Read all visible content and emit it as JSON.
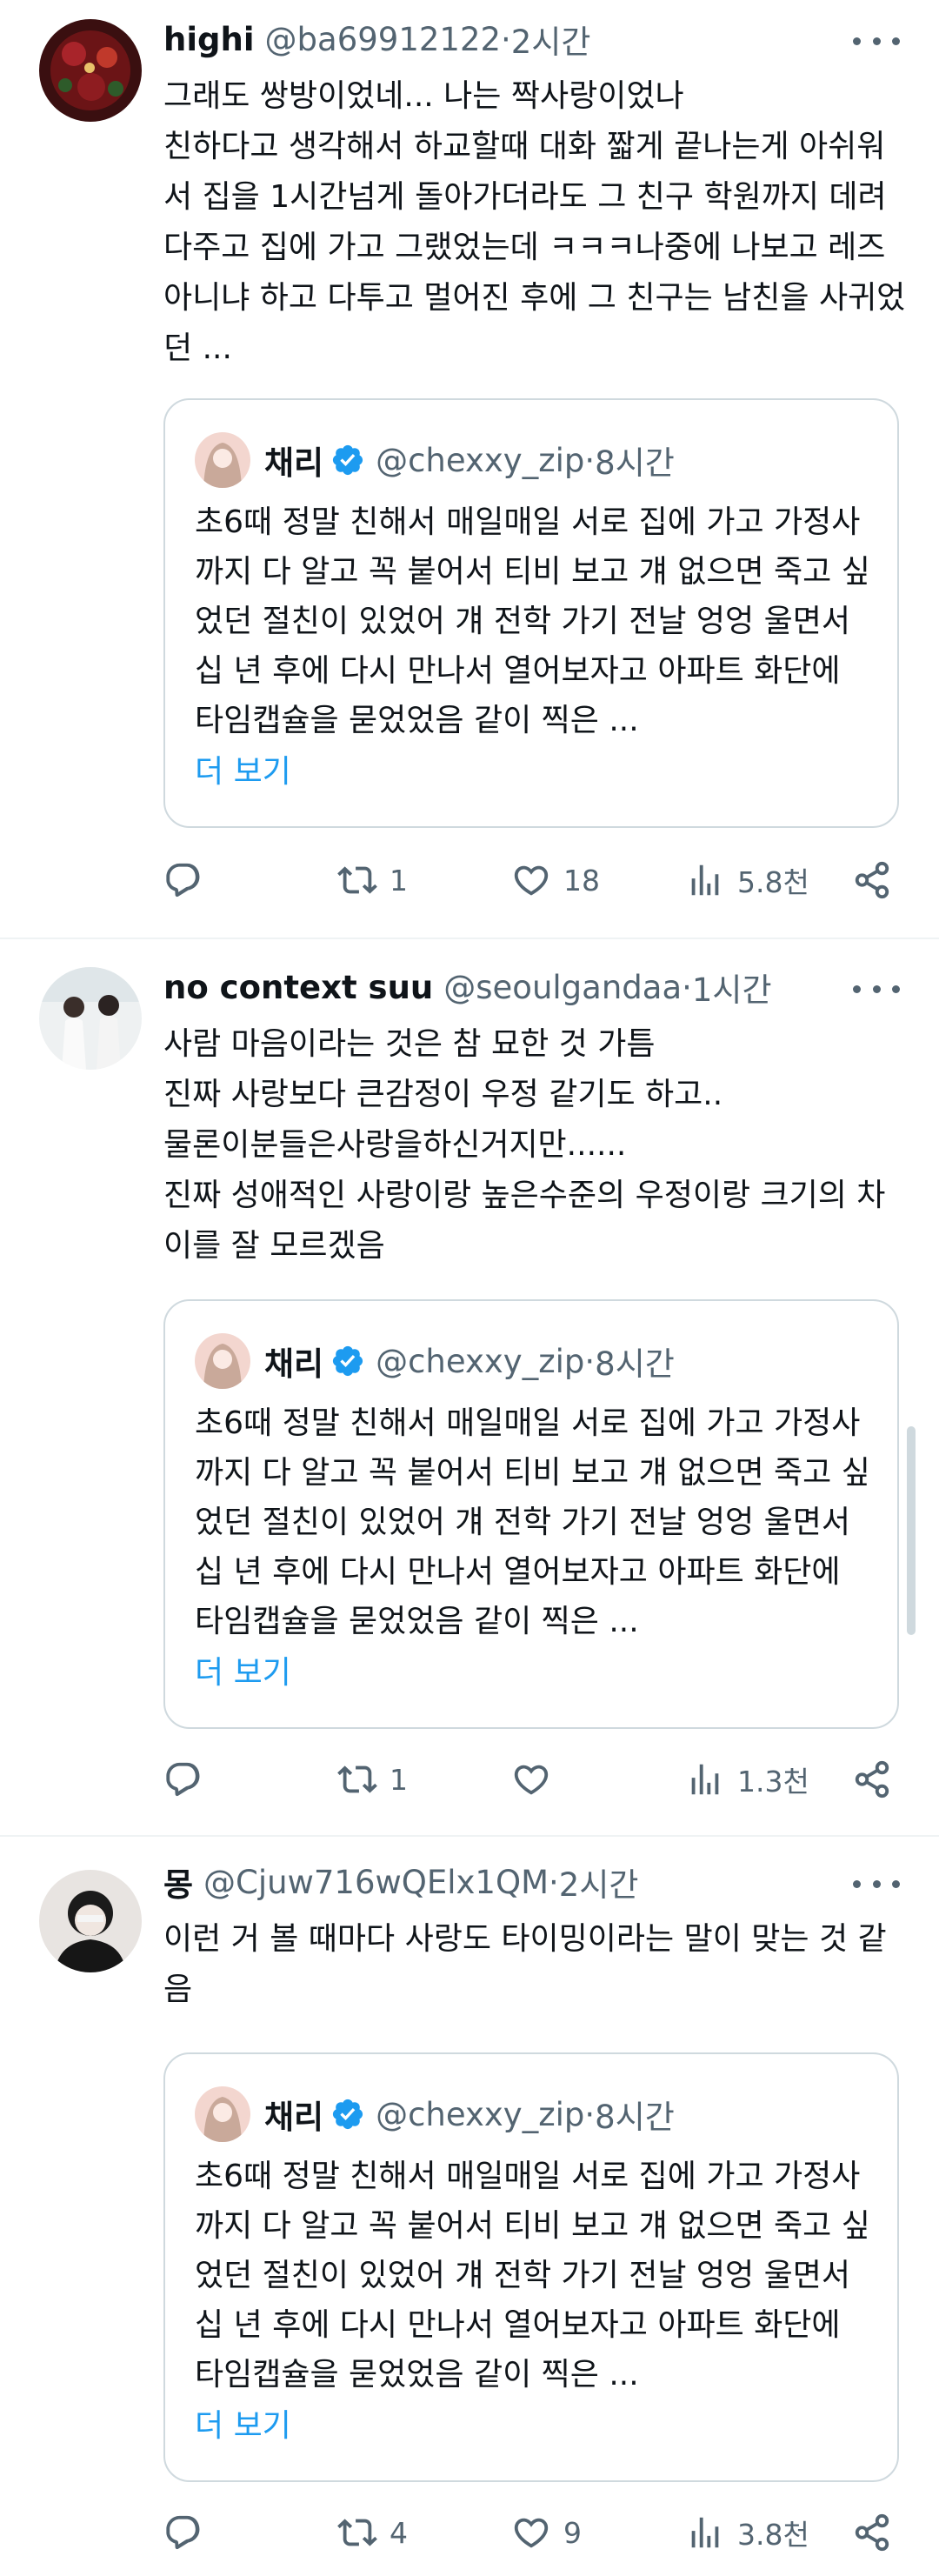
{
  "posts": [
    {
      "display_name": "highi",
      "handle": "@ba69912122",
      "time": "2시간",
      "text": "그래도 쌍방이었네... 나는 짝사랑이었나\n친하다고 생각해서 하교할때 대화 짧게 끝나는게 아쉬워서 집을 1시간넘게 돌아가더라도 그 친구 학원까지 데려다주고 집에 가고 그랬었는데 ㅋㅋㅋ나중에 나보고 레즈아니냐 하고 다투고 멀어진 후에 그 친구는 남친을 사귀었던 ...",
      "quote": {
        "display_name": "채리",
        "handle": "@chexxy_zip",
        "time": "8시간",
        "text": "초6때 정말 친해서 매일매일 서로 집에 가고 가정사까지 다 알고 꼭 붙어서 티비 보고 걔 없으면 죽고 싶었던 절친이 있었어 걔 전학 가기 전날 엉엉 울면서 십 년 후에 다시 만나서 열어보자고 아파트 화단에 타임캡슐을 묻었었음 같이 찍은 ...",
        "show_more": "더 보기"
      },
      "replies": "",
      "reposts": "1",
      "likes": "18",
      "views": "5.8천"
    },
    {
      "display_name": "no context suu",
      "handle": "@seoulgandaa",
      "time": "1시간",
      "text": "사람 마음이라는 것은 참 묘한 것 가틈\n진짜 사랑보다 큰감정이 우정 같기도 하고..\n물론이분들은사랑을하신거지만......\n진짜 성애적인 사랑이랑 높은수준의 우정이랑 크기의 차이를 잘 모르겠음",
      "quote": {
        "display_name": "채리",
        "handle": "@chexxy_zip",
        "time": "8시간",
        "text": "초6때 정말 친해서 매일매일 서로 집에 가고 가정사까지 다 알고 꼭 붙어서 티비 보고 걔 없으면 죽고 싶었던 절친이 있었어 걔 전학 가기 전날 엉엉 울면서 십 년 후에 다시 만나서 열어보자고 아파트 화단에 타임캡슐을 묻었었음 같이 찍은 ...",
        "show_more": "더 보기"
      },
      "replies": "",
      "reposts": "1",
      "likes": "",
      "views": "1.3천"
    },
    {
      "display_name": "몽",
      "handle": "@Cjuw716wQElx1QM",
      "time": "2시간",
      "text": "이런 거 볼 때마다 사랑도 타이밍이라는 말이 맞는 것 같음",
      "quote": {
        "display_name": "채리",
        "handle": "@chexxy_zip",
        "time": "8시간",
        "text": "초6때 정말 친해서 매일매일 서로 집에 가고 가정사까지 다 알고 꼭 붙어서 티비 보고 걔 없으면 죽고 싶었던 절친이 있었어 걔 전학 가기 전날 엉엉 울면서 십 년 후에 다시 만나서 열어보자고 아파트 화단에 타임캡슐을 묻었었음 같이 찍은 ...",
        "show_more": "더 보기"
      },
      "replies": "",
      "reposts": "4",
      "likes": "9",
      "views": "3.8천"
    }
  ],
  "separator": " · ",
  "colors": {
    "text": "#0f1419",
    "secondary": "#536471",
    "link": "#1d9bf0",
    "border": "#cfd9de",
    "divider": "#eff3f4",
    "verified": "#1d9bf0"
  },
  "icons": [
    "more-icon",
    "verified-badge-icon",
    "reply-icon",
    "repost-icon",
    "like-icon",
    "views-icon",
    "share-icon"
  ]
}
